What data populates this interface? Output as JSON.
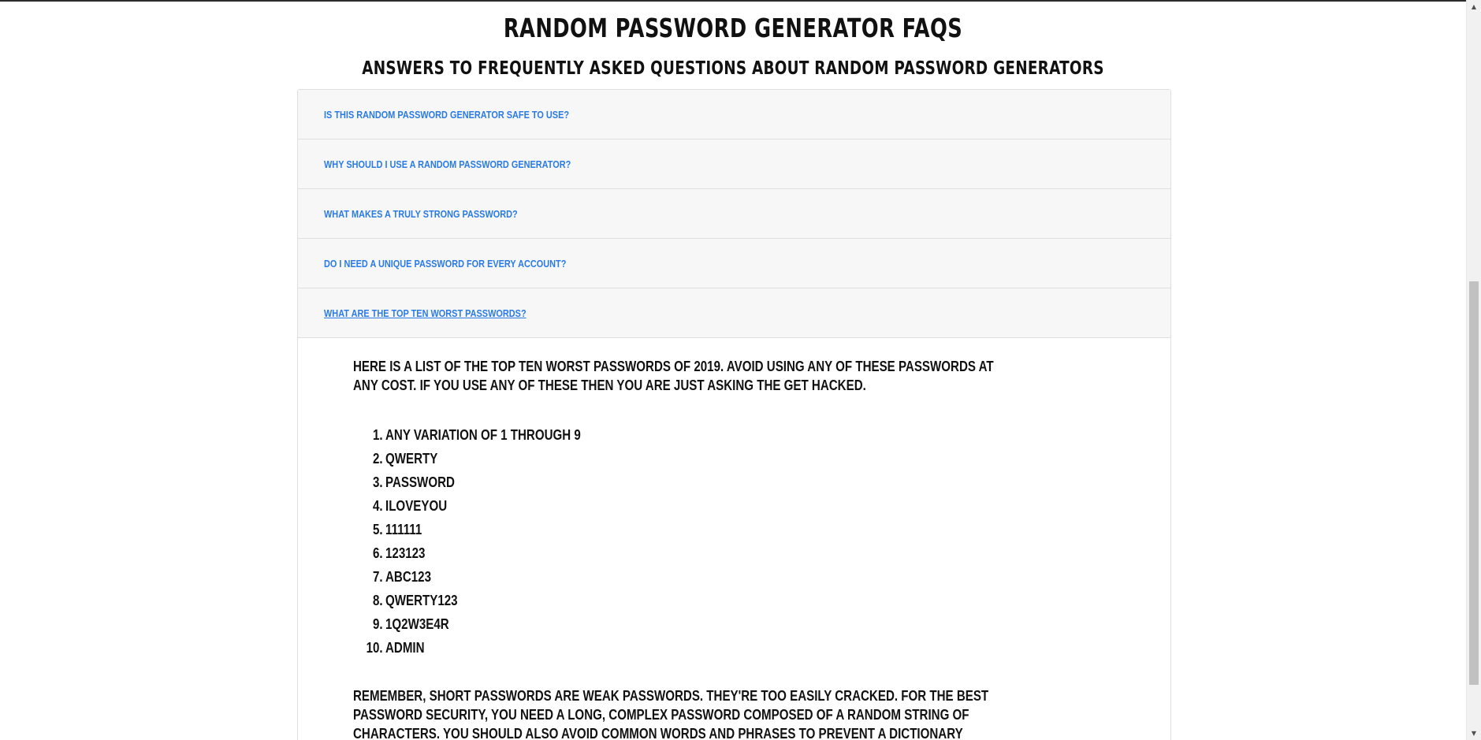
{
  "page": {
    "title": "Random Password Generator FAQs",
    "subtitle": "Answers to Frequently Asked Questions About Random Password Generators"
  },
  "faq": {
    "items": [
      {
        "question": "Is this random password generator safe to use?",
        "active": false
      },
      {
        "question": "Why should I use a random password generator?",
        "active": false
      },
      {
        "question": "What makes a truly strong password?",
        "active": false
      },
      {
        "question": "Do I need a unique password for every account?",
        "active": false
      },
      {
        "question": "What are the top ten worst passwords?",
        "active": true
      }
    ],
    "answer": {
      "intro": "Here is a list of the top ten worst passwords of 2019. Avoid using any of these passwords at any cost. If you use any of these then you are just asking the get hacked.",
      "list": [
        {
          "num": "1.",
          "text": "Any variation of 1 through 9"
        },
        {
          "num": "2.",
          "text": "qwerty"
        },
        {
          "num": "3.",
          "text": "password"
        },
        {
          "num": "4.",
          "text": "iloveyou"
        },
        {
          "num": "5.",
          "text": "111111"
        },
        {
          "num": "6.",
          "text": "123123"
        },
        {
          "num": "7.",
          "text": "abc123"
        },
        {
          "num": "8.",
          "text": "qwerty123"
        },
        {
          "num": "9.",
          "text": "1q2w3e4r"
        },
        {
          "num": "10.",
          "text": "admin"
        }
      ],
      "outro": "Remember, short passwords are weak passwords. They're too easily cracked. For the best password security, you need a long, complex password composed of a random string of characters. You should also avoid common words and phrases to prevent a dictionary attack. Only then will you have a strong password."
    }
  },
  "scrollbar": {
    "up_icon": "▲",
    "down_icon": "▼",
    "position": 0.62
  },
  "colors": {
    "link": "#2a7be8",
    "heading": "#111111",
    "panel_bg": "#f7f7f7",
    "border": "#dfdfdf"
  }
}
